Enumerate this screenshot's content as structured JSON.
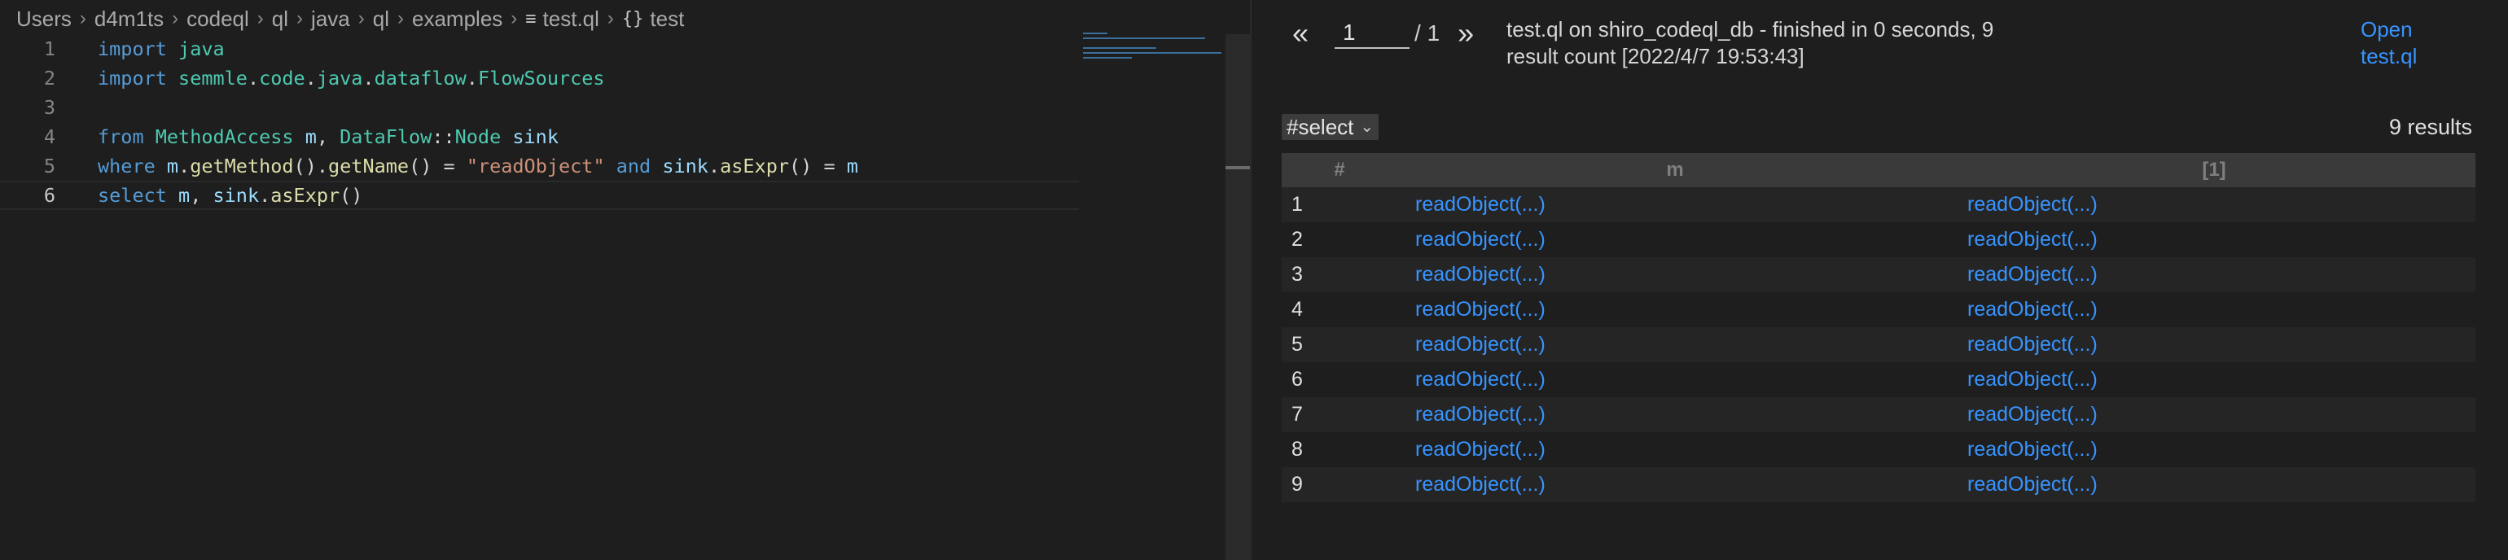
{
  "breadcrumb": {
    "items": [
      "Users",
      "d4m1ts",
      "codeql",
      "ql",
      "java",
      "ql",
      "examples"
    ],
    "file_icon": "≡",
    "file": "test.ql",
    "symbol_icon": "{}",
    "symbol": "test"
  },
  "editor": {
    "line_numbers": [
      "1",
      "2",
      "3",
      "4",
      "5",
      "6"
    ],
    "lines": [
      [
        {
          "t": "import",
          "c": "kw"
        },
        {
          "t": " "
        },
        {
          "t": "java",
          "c": "ty"
        }
      ],
      [
        {
          "t": "import",
          "c": "kw"
        },
        {
          "t": " "
        },
        {
          "t": "semmle",
          "c": "ty"
        },
        {
          "t": "."
        },
        {
          "t": "code",
          "c": "ty"
        },
        {
          "t": "."
        },
        {
          "t": "java",
          "c": "ty"
        },
        {
          "t": "."
        },
        {
          "t": "dataflow",
          "c": "ty"
        },
        {
          "t": "."
        },
        {
          "t": "FlowSources",
          "c": "ty"
        }
      ],
      [],
      [
        {
          "t": "from",
          "c": "kw"
        },
        {
          "t": " "
        },
        {
          "t": "MethodAccess",
          "c": "ty"
        },
        {
          "t": " "
        },
        {
          "t": "m",
          "c": "vr"
        },
        {
          "t": ", "
        },
        {
          "t": "DataFlow",
          "c": "ty"
        },
        {
          "t": "::"
        },
        {
          "t": "Node",
          "c": "ty"
        },
        {
          "t": " "
        },
        {
          "t": "sink",
          "c": "vr"
        }
      ],
      [
        {
          "t": "where",
          "c": "kw"
        },
        {
          "t": " "
        },
        {
          "t": "m",
          "c": "vr"
        },
        {
          "t": "."
        },
        {
          "t": "getMethod",
          "c": "fn"
        },
        {
          "t": "()."
        },
        {
          "t": "getName",
          "c": "fn"
        },
        {
          "t": "() = "
        },
        {
          "t": "\"readObject\"",
          "c": "st"
        },
        {
          "t": " "
        },
        {
          "t": "and",
          "c": "kw"
        },
        {
          "t": " "
        },
        {
          "t": "sink",
          "c": "vr"
        },
        {
          "t": "."
        },
        {
          "t": "asExpr",
          "c": "fn"
        },
        {
          "t": "() = "
        },
        {
          "t": "m",
          "c": "vr"
        }
      ],
      [
        {
          "t": "select",
          "c": "kw"
        },
        {
          "t": " "
        },
        {
          "t": "m",
          "c": "vr"
        },
        {
          "t": ", "
        },
        {
          "t": "sink",
          "c": "vr"
        },
        {
          "t": "."
        },
        {
          "t": "asExpr",
          "c": "fn"
        },
        {
          "t": "()"
        }
      ]
    ]
  },
  "results": {
    "pager": {
      "prev": "«",
      "page": "1",
      "total": "/ 1",
      "next": "»"
    },
    "summary": "test.ql on shiro_codeql_db - finished in 0 seconds, 9 result count [2022/4/7 19:53:43]",
    "open_link": "Open test.ql",
    "select_label": "#select",
    "count_label": "9 results",
    "columns": [
      "#",
      "m",
      "[1]"
    ],
    "rows": [
      [
        "1",
        "readObject(...)",
        "readObject(...)"
      ],
      [
        "2",
        "readObject(...)",
        "readObject(...)"
      ],
      [
        "3",
        "readObject(...)",
        "readObject(...)"
      ],
      [
        "4",
        "readObject(...)",
        "readObject(...)"
      ],
      [
        "5",
        "readObject(...)",
        "readObject(...)"
      ],
      [
        "6",
        "readObject(...)",
        "readObject(...)"
      ],
      [
        "7",
        "readObject(...)",
        "readObject(...)"
      ],
      [
        "8",
        "readObject(...)",
        "readObject(...)"
      ],
      [
        "9",
        "readObject(...)",
        "readObject(...)"
      ]
    ]
  },
  "colors": {
    "keyword": "#569cd6",
    "type": "#4ec9b0",
    "variable": "#9cdcfe",
    "function": "#dcdcaa",
    "string": "#ce9178",
    "link": "#3794ff",
    "background": "#1e1e1e"
  }
}
